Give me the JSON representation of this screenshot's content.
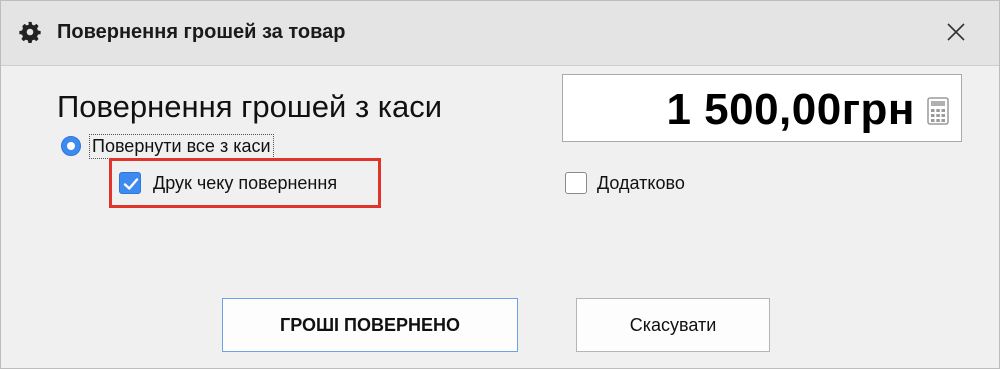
{
  "window": {
    "title": "Повернення грошей за товар",
    "icons": {
      "title": "gear-icon",
      "close": "close-icon",
      "calculator": "calculator-icon"
    }
  },
  "main": {
    "heading": "Повернення грошей з каси",
    "amount": "1 500,00грн",
    "return_all_option": {
      "label": "Повернути все з каси",
      "selected": true
    },
    "print_receipt_option": {
      "label": "Друк чеку повернення",
      "checked": true
    },
    "additional_option": {
      "label": "Додатково",
      "checked": false
    }
  },
  "buttons": {
    "confirm_label": "ГРОШІ ПОВЕРНЕНО",
    "cancel_label": "Скасувати"
  },
  "colors": {
    "accent": "#3d8af0",
    "highlight": "#e0342a",
    "primary_border": "#6aa3e8"
  }
}
